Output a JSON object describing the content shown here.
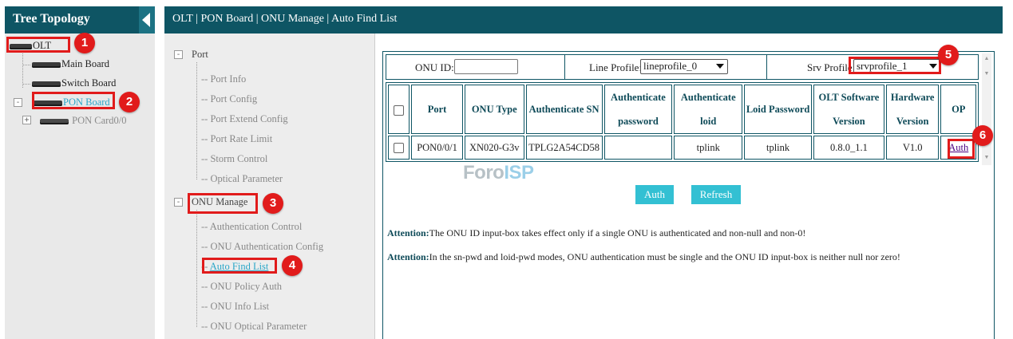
{
  "tree": {
    "title": "Tree Topology",
    "items": [
      {
        "label": "OLT",
        "icon": "device-icon"
      },
      {
        "label": "Main Board",
        "icon": "device-icon"
      },
      {
        "label": "Switch Board",
        "icon": "device-icon"
      },
      {
        "label": "PON Board",
        "icon": "device-icon"
      },
      {
        "label": "PON Card0/0",
        "icon": "device-icon"
      }
    ]
  },
  "header": {
    "breadcrumb": "OLT | PON Board | ONU Manage | Auto Find List"
  },
  "menu": {
    "port_group": "Port",
    "port_items": [
      "Port Info",
      "Port Config",
      "Port Extend Config",
      "Port Rate Limit",
      "Storm Control",
      "Optical Parameter"
    ],
    "onu_group": "ONU Manage",
    "onu_items": [
      "Authentication Control",
      "ONU Authentication Config",
      "Auto Find List",
      "ONU Policy Auth",
      "ONU Info List",
      "ONU Optical Parameter"
    ],
    "active_item": "Auto Find List"
  },
  "filters": {
    "onu_id_label": "ONU ID:",
    "onu_id_value": "",
    "line_profile_label": "Line Profile:",
    "line_profile_value": "lineprofile_0",
    "srv_profile_label": "Srv Profile:",
    "srv_profile_value": "srvprofile_1"
  },
  "table": {
    "columns": [
      "Port",
      "ONU Type",
      "Authenticate SN",
      "Authenticate password",
      "Authenticate loid",
      "Loid Password",
      "OLT Software Version",
      "Hardware Version",
      "OP"
    ],
    "rows": [
      {
        "port": "PON0/0/1",
        "onu_type": "XN020-G3v",
        "sn": "TPLG2A54CD58",
        "password": "",
        "loid": "tplink",
        "loid_password": "tplink",
        "olt_sw": "0.8.0_1.1",
        "hw": "V1.0",
        "op": "Auth"
      }
    ]
  },
  "buttons": {
    "auth": "Auth",
    "refresh": "Refresh"
  },
  "attention": {
    "label": "Attention:",
    "line1": "The ONU ID input-box takes effect only if a single ONU is authenticated and non-null and non-0!",
    "line2": "In the sn-pwd and loid-pwd modes, ONU authentication must be single and the ONU ID input-box is neither null nor zero!"
  },
  "watermark": {
    "part1": "Foro",
    "part2": "ISP"
  },
  "annotations": [
    "1",
    "2",
    "3",
    "4",
    "5",
    "6"
  ],
  "colors": {
    "header": "#0e5564",
    "button": "#33c0d3",
    "highlight": "#e11b1b",
    "active_link": "#2aa6c8"
  }
}
